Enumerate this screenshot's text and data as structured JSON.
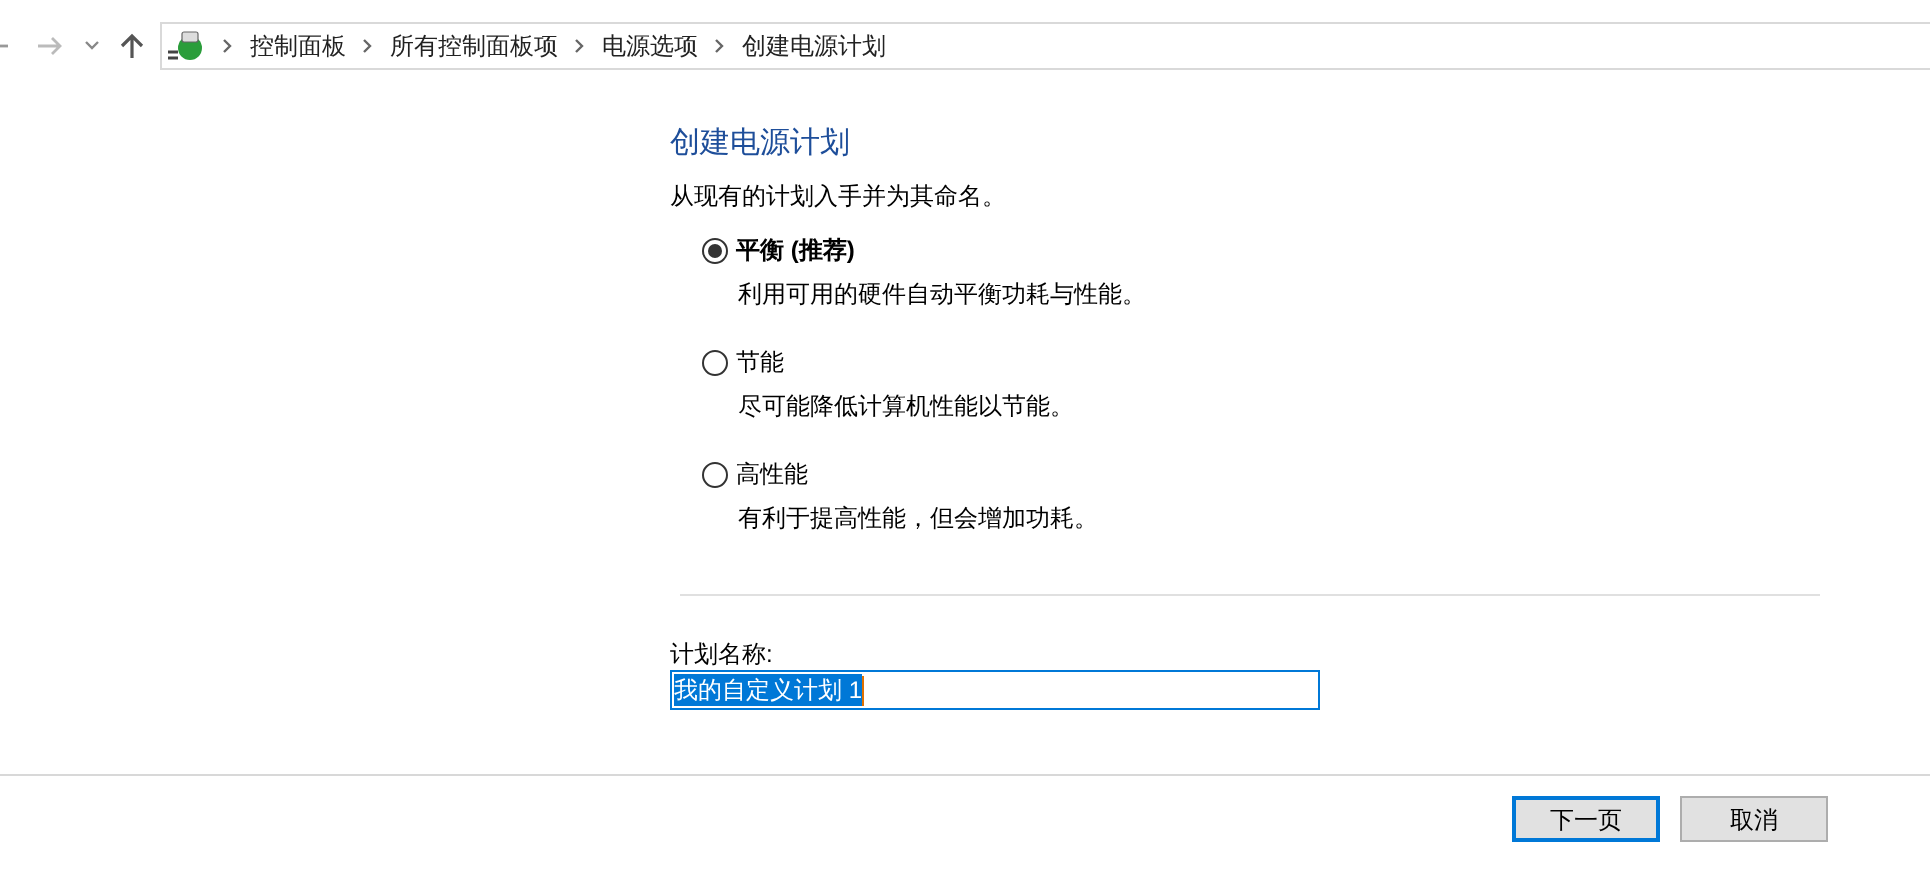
{
  "breadcrumbs": [
    "控制面板",
    "所有控制面板项",
    "电源选项",
    "创建电源计划"
  ],
  "title": "创建电源计划",
  "intro": "从现有的计划入手并为其命名。",
  "plans": [
    {
      "label": "平衡 (推荐)",
      "description": "利用可用的硬件自动平衡功耗与性能。",
      "selected": true
    },
    {
      "label": "节能",
      "description": "尽可能降低计算机性能以节能。",
      "selected": false
    },
    {
      "label": "高性能",
      "description": "有利于提高性能，但会增加功耗。",
      "selected": false
    }
  ],
  "name_field": {
    "label": "计划名称:",
    "value": "我的自定义计划 1"
  },
  "buttons": [
    {
      "label": "下一页",
      "default": true
    },
    {
      "label": "取消",
      "default": false
    }
  ]
}
